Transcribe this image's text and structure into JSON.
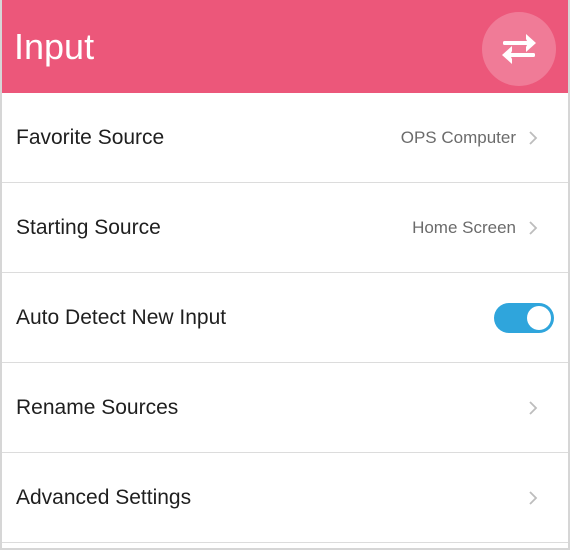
{
  "header": {
    "title": "Input",
    "action_icon": "swap-arrows-icon",
    "background_color": "#ec577a"
  },
  "rows": [
    {
      "label": "Favorite Source",
      "value": "OPS Computer",
      "type": "chevron"
    },
    {
      "label": "Starting Source",
      "value": "Home Screen",
      "type": "chevron"
    },
    {
      "label": "Auto Detect New Input",
      "type": "toggle",
      "on": true
    },
    {
      "label": "Rename Sources",
      "value": "",
      "type": "chevron"
    },
    {
      "label": "Advanced Settings",
      "value": "",
      "type": "chevron"
    }
  ],
  "colors": {
    "toggle_on": "#2fa5dc",
    "divider": "#dcdcdc"
  }
}
